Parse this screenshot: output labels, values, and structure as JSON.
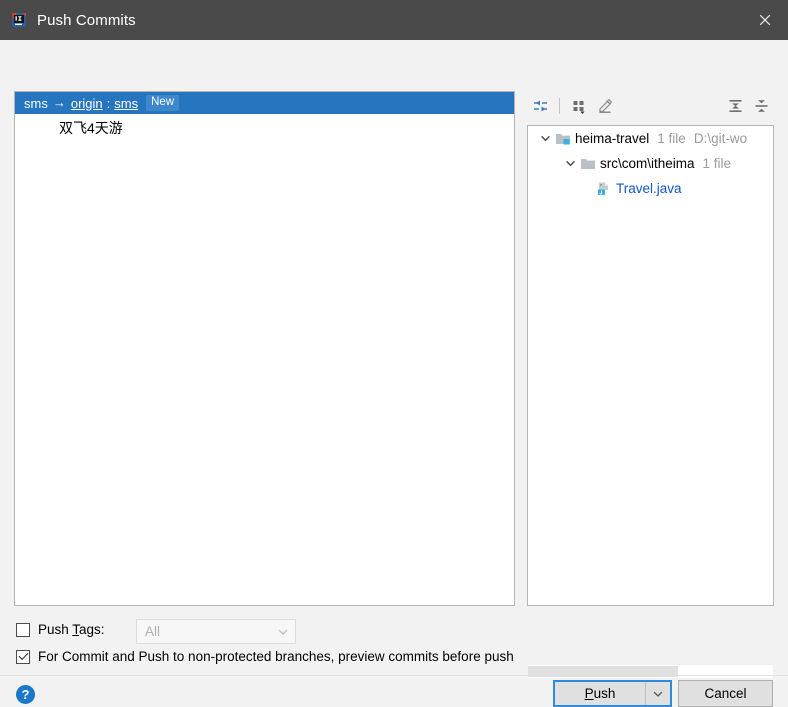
{
  "window": {
    "title": "Push Commits",
    "app_icon": "intellij-idea-icon",
    "close_icon": "close-icon"
  },
  "commits": {
    "repo_row": {
      "source_branch": "sms",
      "arrow": "→",
      "remote": "origin",
      "colon": ":",
      "target_branch": "sms",
      "badge": "New"
    },
    "rows": [
      {
        "message": "双飞4天游"
      }
    ]
  },
  "tree_toolbar": {
    "buttons": [
      {
        "name": "collapse-selection-icon",
        "title": "Collapse"
      },
      {
        "name": "group-by-icon",
        "title": "Group By"
      },
      {
        "name": "edit-source-icon",
        "title": "Edit Source"
      },
      {
        "name": "expand-all-icon",
        "title": "Expand All"
      },
      {
        "name": "collapse-all-icon",
        "title": "Collapse All"
      }
    ]
  },
  "tree": {
    "nodes": [
      {
        "icon": "module-folder-icon",
        "label": "heima-travel",
        "meta": "1 file",
        "path": "D:\\git-wo",
        "expanded": true,
        "is_link": false
      },
      {
        "icon": "folder-icon",
        "label": "src\\com\\itheima",
        "meta": "1 file",
        "path": "",
        "expanded": true,
        "is_link": false
      },
      {
        "icon": "java-file-icon",
        "label": "Travel.java",
        "meta": "",
        "path": "",
        "expanded": null,
        "is_link": true
      }
    ]
  },
  "options": {
    "push_tags": {
      "checked": false,
      "label_before": "Push ",
      "label_mnemonic": "T",
      "label_after": "ags:"
    },
    "tags_combo": {
      "value": "All",
      "enabled": false,
      "arrow_icon": "chevron-down-icon"
    },
    "preview_commits": {
      "checked": true,
      "label": "For Commit and Push to non-protected branches, preview commits before push"
    }
  },
  "footer": {
    "help_icon": "help-icon",
    "help_glyph": "?",
    "push": {
      "label_mnemonic": "P",
      "label_rest": "ush",
      "arrow_icon": "chevron-down-icon"
    },
    "cancel": {
      "label": "Cancel"
    }
  },
  "colors": {
    "titlebar_bg": "#4a4a4a",
    "selection_blue": "#2675bf",
    "badge_blue": "#3d87cc",
    "link_blue": "#1155cc",
    "focus_blue": "#2f8ae0",
    "help_blue": "#1a78c8",
    "dialog_bg": "#f2f2f2",
    "meta_gray": "#9b9b9b"
  }
}
